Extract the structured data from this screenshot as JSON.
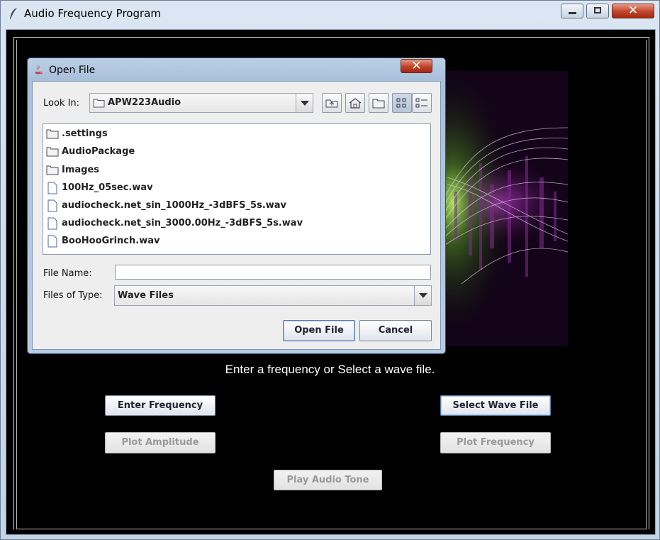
{
  "main_window": {
    "title": "Audio Frequency Program",
    "prompt": "Enter a frequency or Select a wave file.",
    "buttons": {
      "enter_frequency": "Enter Frequency",
      "select_wave_file": "Select Wave File",
      "plot_amplitude": "Plot Amplitude",
      "plot_frequency": "Plot Frequency",
      "play_audio_tone": "Play Audio Tone"
    }
  },
  "dialog": {
    "title": "Open File",
    "look_in_label": "Look In:",
    "look_in_value": "APW223Audio",
    "files": [
      {
        "name": ".settings",
        "kind": "folder"
      },
      {
        "name": "AudioPackage",
        "kind": "folder"
      },
      {
        "name": "Images",
        "kind": "folder"
      },
      {
        "name": "100Hz_05sec.wav",
        "kind": "file"
      },
      {
        "name": "audiocheck.net_sin_1000Hz_-3dBFS_5s.wav",
        "kind": "file"
      },
      {
        "name": "audiocheck.net_sin_3000.00Hz_-3dBFS_5s.wav",
        "kind": "file"
      },
      {
        "name": "BooHooGrinch.wav",
        "kind": "file"
      }
    ],
    "file_name_label": "File Name:",
    "file_name_value": "",
    "files_of_type_label": "Files of Type:",
    "files_of_type_value": "Wave Files",
    "open_button": "Open File",
    "cancel_button": "Cancel"
  },
  "colors": {
    "background": "#000000",
    "titlebar": "#c3d4e7",
    "close_button": "#c0432a"
  }
}
